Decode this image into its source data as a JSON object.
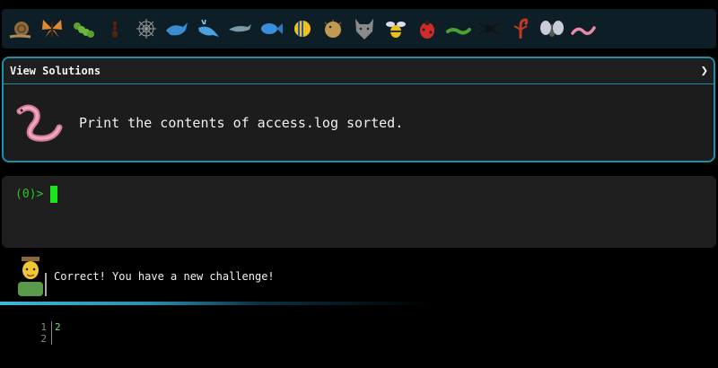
{
  "creatures": [
    {
      "name": "snail-icon"
    },
    {
      "name": "butterfly-icon"
    },
    {
      "name": "caterpillar-icon"
    },
    {
      "name": "ant-icon"
    },
    {
      "name": "spider-web-icon"
    },
    {
      "name": "whale-icon"
    },
    {
      "name": "spouting-whale-icon"
    },
    {
      "name": "dolphin-icon"
    },
    {
      "name": "fish-icon"
    },
    {
      "name": "tropical-fish-icon"
    },
    {
      "name": "blowfish-icon"
    },
    {
      "name": "wolf-icon"
    },
    {
      "name": "bee-icon"
    },
    {
      "name": "ladybug-icon"
    },
    {
      "name": "worm-icon"
    },
    {
      "name": "spider-icon"
    },
    {
      "name": "scorpion-icon"
    },
    {
      "name": "fly-icon"
    },
    {
      "name": "worm-pink-icon"
    }
  ],
  "challenge": {
    "title": "View Solutions",
    "prompt": "Print the contents of access.log sorted."
  },
  "terminal": {
    "prompt": "(0)>"
  },
  "feedback": {
    "message": "Correct! You have a new challenge!"
  },
  "progress": {
    "fraction": 0.6
  },
  "output": {
    "line_numbers": [
      "1",
      "2"
    ],
    "lines": [
      "2",
      ""
    ]
  },
  "colors": {
    "accent": "#1f8fa8",
    "prompt_green": "#2ec22e",
    "cursor_green": "#19e619"
  }
}
